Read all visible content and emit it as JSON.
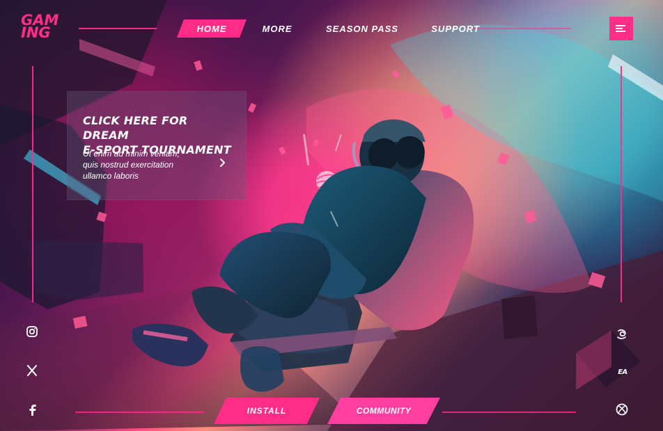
{
  "logo": {
    "text": "GAM\nING"
  },
  "nav": {
    "items": [
      {
        "label": "HOME"
      },
      {
        "label": "MORE"
      },
      {
        "label": "SEASON PASS"
      },
      {
        "label": "SUPPORT"
      }
    ],
    "menu_icon": "menu-icon"
  },
  "promo": {
    "title": "CLICK HERE FOR DREAM\nE-SPORT TOURNAMENT",
    "body": "Ut enim ad minim veniam,\nquis nostrud exercitation\nullamco laboris",
    "arrow_icon": "chevron-right-icon"
  },
  "social": [
    {
      "icon": "instagram-icon"
    },
    {
      "icon": "x-icon"
    },
    {
      "icon": "facebook-icon"
    }
  ],
  "brands": [
    {
      "icon": "brand-swirl-icon"
    },
    {
      "text": "EA",
      "icon": "ea-logo-icon"
    },
    {
      "icon": "xbox-icon"
    }
  ],
  "actions": {
    "install": "INSTALL",
    "community": "COMMUNITY"
  },
  "colors": {
    "accent": "#ff2d88",
    "text": "#ffffff",
    "panel": "#685d7f"
  }
}
